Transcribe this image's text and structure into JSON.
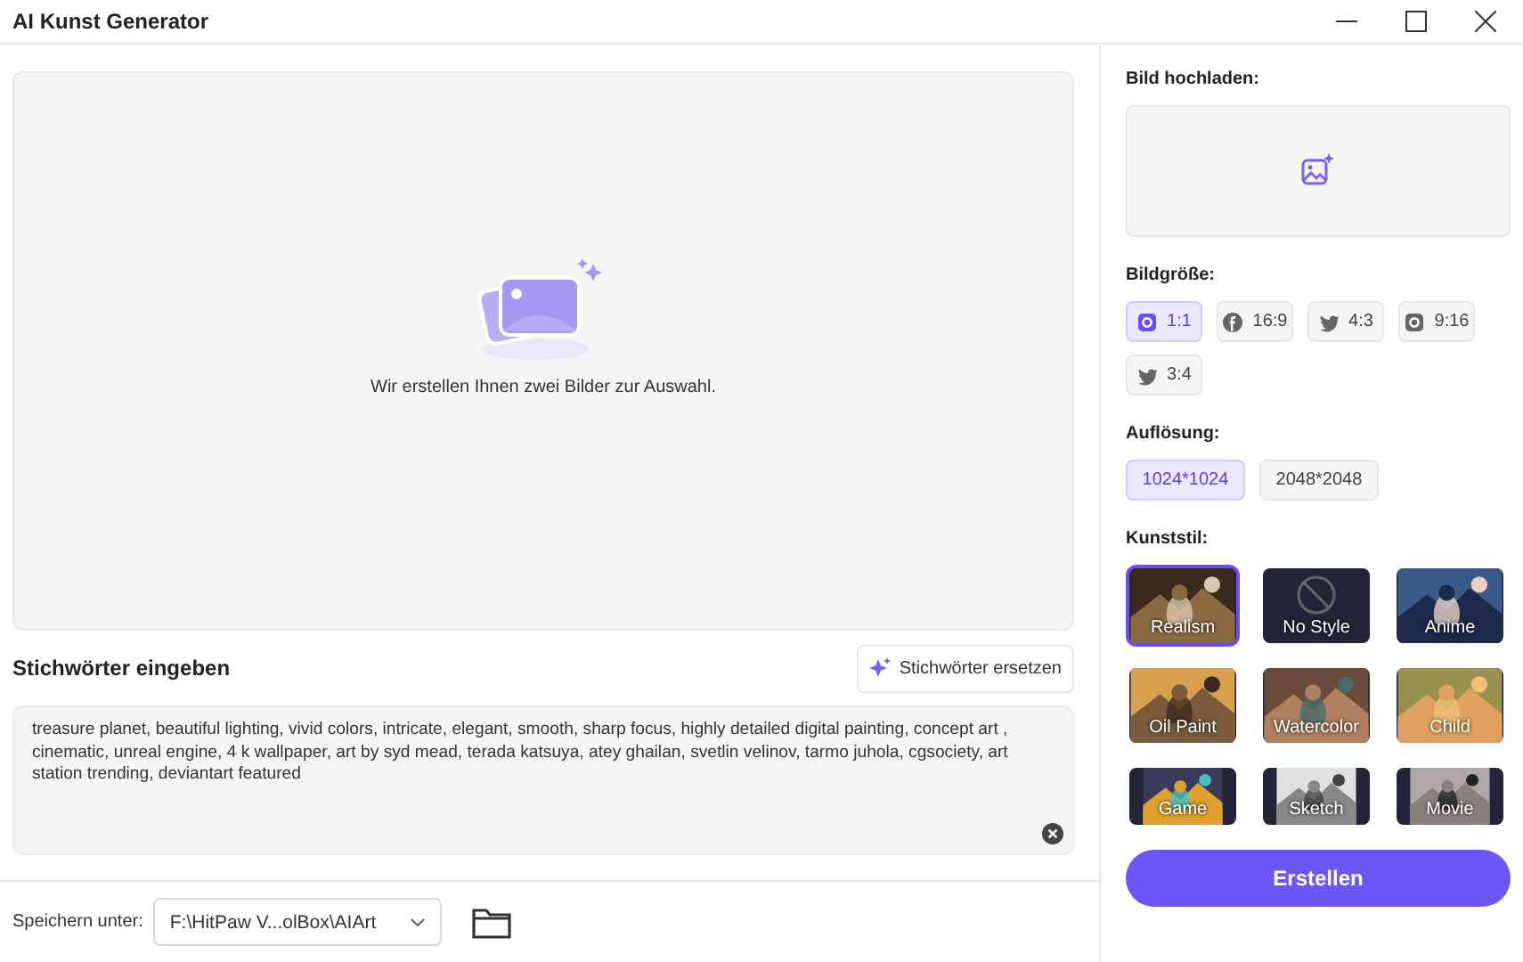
{
  "window": {
    "title": "AI Kunst Generator"
  },
  "preview": {
    "message": "Wir erstellen Ihnen zwei Bilder zur Auswahl."
  },
  "keywords": {
    "heading": "Stichwörter eingeben",
    "replace_button": "Stichwörter ersetzen",
    "value": "treasure planet, beautiful lighting, vivid colors, intricate, elegant, smooth, sharp focus, highly detailed digital painting, concept art , cinematic, unreal engine, 4 k wallpaper, art by syd mead, terada katsuya, atey ghailan, svetlin velinov, tarmo juhola, cgsociety, art station trending, deviantart featured"
  },
  "save": {
    "label": "Speichern unter:",
    "path": "F:\\HitPaw V...olBox\\AIArt"
  },
  "upload": {
    "heading": "Bild hochladen:"
  },
  "sizes": {
    "heading": "Bildgröße:",
    "options": [
      {
        "label": "1:1",
        "kind": "camera",
        "selected": true
      },
      {
        "label": "16:9",
        "kind": "circle",
        "selected": false
      },
      {
        "label": "4:3",
        "kind": "bird",
        "selected": false
      },
      {
        "label": "9:16",
        "kind": "camera",
        "selected": false
      },
      {
        "label": "3:4",
        "kind": "bird",
        "selected": false
      }
    ]
  },
  "resolution": {
    "heading": "Auflösung:",
    "options": [
      {
        "label": "1024*1024",
        "selected": true
      },
      {
        "label": "2048*2048",
        "selected": false
      }
    ]
  },
  "styles": {
    "heading": "Kunststil:",
    "options": [
      {
        "label": "Realism",
        "kind": "picture",
        "selected": true
      },
      {
        "label": "No Style",
        "kind": "none",
        "selected": false
      },
      {
        "label": "Anime",
        "kind": "picture",
        "selected": false
      },
      {
        "label": "Oil Paint",
        "kind": "picture",
        "selected": false
      },
      {
        "label": "Watercolor",
        "kind": "picture",
        "selected": false
      },
      {
        "label": "Child",
        "kind": "picture",
        "selected": false
      },
      {
        "label": "Game",
        "kind": "picture",
        "selected": false
      },
      {
        "label": "Sketch",
        "kind": "picture",
        "selected": false
      },
      {
        "label": "Movie",
        "kind": "picture",
        "selected": false
      }
    ]
  },
  "create_button": "Erstellen"
}
